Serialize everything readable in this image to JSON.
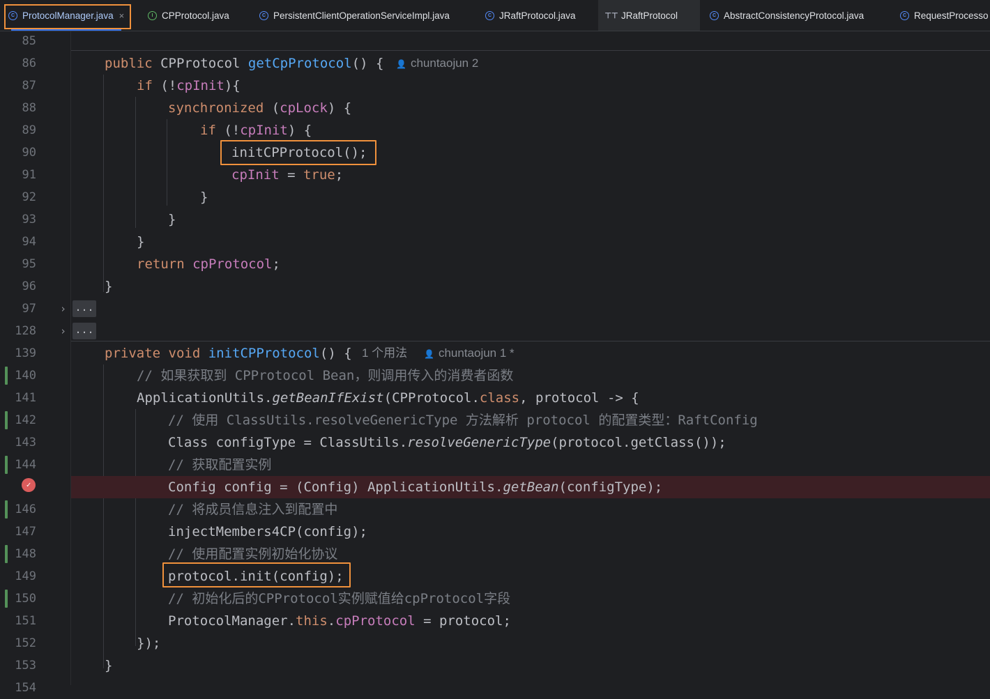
{
  "tabs": [
    {
      "label": "ProtocolManager.java",
      "icon": "class-icon",
      "active": true
    },
    {
      "label": "CPProtocol.java",
      "icon": "interface-icon"
    },
    {
      "label": "PersistentClientOperationServiceImpl.java",
      "icon": "class-icon"
    },
    {
      "label": "JRaftProtocol.java",
      "icon": "class-icon"
    },
    {
      "label": "JRaftProtocol",
      "icon": "structure-icon"
    },
    {
      "label": "AbstractConsistencyProtocol.java",
      "icon": "class-icon"
    },
    {
      "label": "RequestProcesso",
      "icon": "class-icon"
    }
  ],
  "close_glyph": "×",
  "code": {
    "l85": {
      "num": "85"
    },
    "l86": {
      "num": "86",
      "t1": "public ",
      "t2": "CPProtocol ",
      "t3": "getCpProtocol",
      "t4": "() {",
      "hint": "chuntaojun 2"
    },
    "l87": {
      "num": "87",
      "t1": "if ",
      "t2": "(!",
      "t3": "cpInit",
      "t4": "){"
    },
    "l88": {
      "num": "88",
      "t1": "synchronized ",
      "t2": "(",
      "t3": "cpLock",
      "t4": ") {"
    },
    "l89": {
      "num": "89",
      "t1": "if ",
      "t2": "(!",
      "t3": "cpInit",
      "t4": ") {"
    },
    "l90": {
      "num": "90",
      "t1": "initCPProtocol();"
    },
    "l91": {
      "num": "91",
      "t1": "cpInit",
      "t2": " = ",
      "t3": "true",
      ";": ";",
      "t4": ";"
    },
    "l92": {
      "num": "92",
      "t1": "}"
    },
    "l93": {
      "num": "93",
      "t1": "}"
    },
    "l94": {
      "num": "94",
      "t1": "}"
    },
    "l95": {
      "num": "95",
      "t1": "return ",
      "t2": "cpProtocol",
      "t3": ";"
    },
    "l96": {
      "num": "96",
      "t1": "}"
    },
    "l97": {
      "num": "97",
      "fold": "..."
    },
    "l128": {
      "num": "128",
      "fold": "..."
    },
    "l139": {
      "num": "139",
      "t1": "private void ",
      "t2": "initCPProtocol",
      "t3": "() {",
      "hint_usage": "1 个用法",
      "hint": "chuntaojun 1 *"
    },
    "l140": {
      "num": "140",
      "t1": "// 如果获取到 CPProtocol Bean，则调用传入的消费者函数"
    },
    "l141": {
      "num": "141",
      "t1": "ApplicationUtils.",
      "t2": "getBeanIfExist",
      "t3": "(CPProtocol.",
      "t4": "class",
      ",": ",",
      "t5": ", protocol -> {"
    },
    "l142": {
      "num": "142",
      "t1": "// 使用 ClassUtils.resolveGenericType 方法解析 protocol 的配置类型：RaftConfig"
    },
    "l143": {
      "num": "143",
      "t1": "Class configType = ClassUtils.",
      "t2": "resolveGenericType",
      "t3": "(protocol.getClass());"
    },
    "l144": {
      "num": "144",
      "t1": "// 获取配置实例"
    },
    "l145": {
      "num": "",
      "t1": "Config config = (Config) ApplicationUtils.",
      "t2": "getBean",
      "t3": "(configType);"
    },
    "l146": {
      "num": "146",
      "t1": "// 将成员信息注入到配置中"
    },
    "l147": {
      "num": "147",
      "t1": "injectMembers4CP(config);"
    },
    "l148": {
      "num": "148",
      "t1": "// 使用配置实例初始化协议"
    },
    "l149": {
      "num": "149",
      "t1": "protocol.init(config);"
    },
    "l150": {
      "num": "150",
      "t1": "// 初始化后的CPProtocol实例赋值给cpProtocol字段"
    },
    "l151": {
      "num": "151",
      "t1": "ProtocolManager.",
      "t2": "this",
      ".": ".",
      "t3": ".",
      "t4": "cpProtocol",
      "t5": " = protocol;"
    },
    "l152": {
      "num": "152",
      "t1": "});"
    },
    "l153": {
      "num": "153",
      "t1": "}"
    },
    "l154": {
      "num": "154"
    }
  }
}
